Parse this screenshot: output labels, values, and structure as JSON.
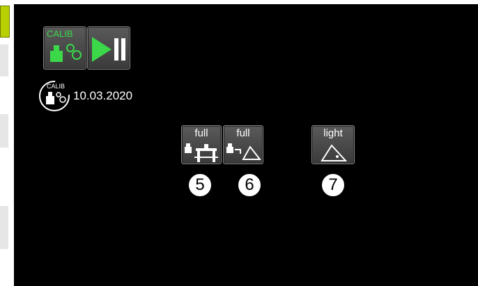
{
  "top_buttons": {
    "calib_label": "CALIB"
  },
  "calibration": {
    "icon_label": "CALIB",
    "date": "10.03.2020"
  },
  "weigh_buttons": [
    {
      "label": "full",
      "callout": "5"
    },
    {
      "label": "full",
      "callout": "6"
    },
    {
      "label": "light",
      "callout": "7"
    }
  ],
  "colors": {
    "screen_bg": "#000000",
    "accent_green": "#3bd84a",
    "sidebar_accent": "#b8d000"
  }
}
